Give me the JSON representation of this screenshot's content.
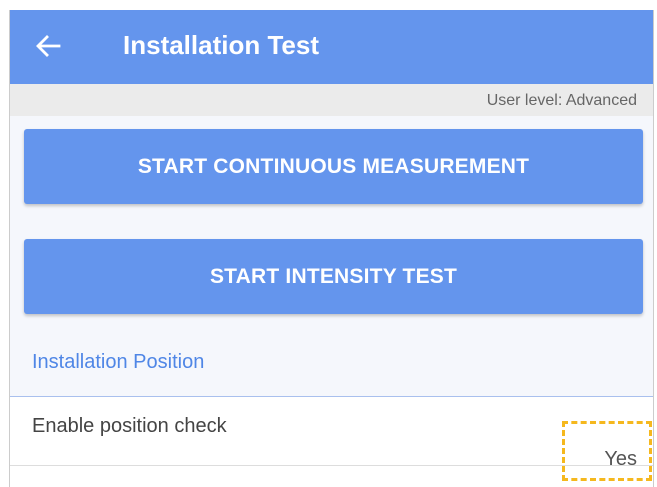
{
  "app_bar": {
    "title": "Installation Test",
    "back_icon": "arrow-left-icon",
    "background": "#6495ed"
  },
  "user_level": {
    "text": "User level: Advanced"
  },
  "actions": {
    "continuous_label": "START CONTINUOUS MEASUREMENT",
    "intensity_label": "START INTENSITY TEST"
  },
  "section": {
    "title": "Installation Position"
  },
  "settings": {
    "position_check": {
      "label": "Enable position check",
      "value": "Yes"
    }
  },
  "colors": {
    "accent": "#6495ed",
    "section_title": "#4f86e6",
    "highlight": "#f5b81e"
  }
}
